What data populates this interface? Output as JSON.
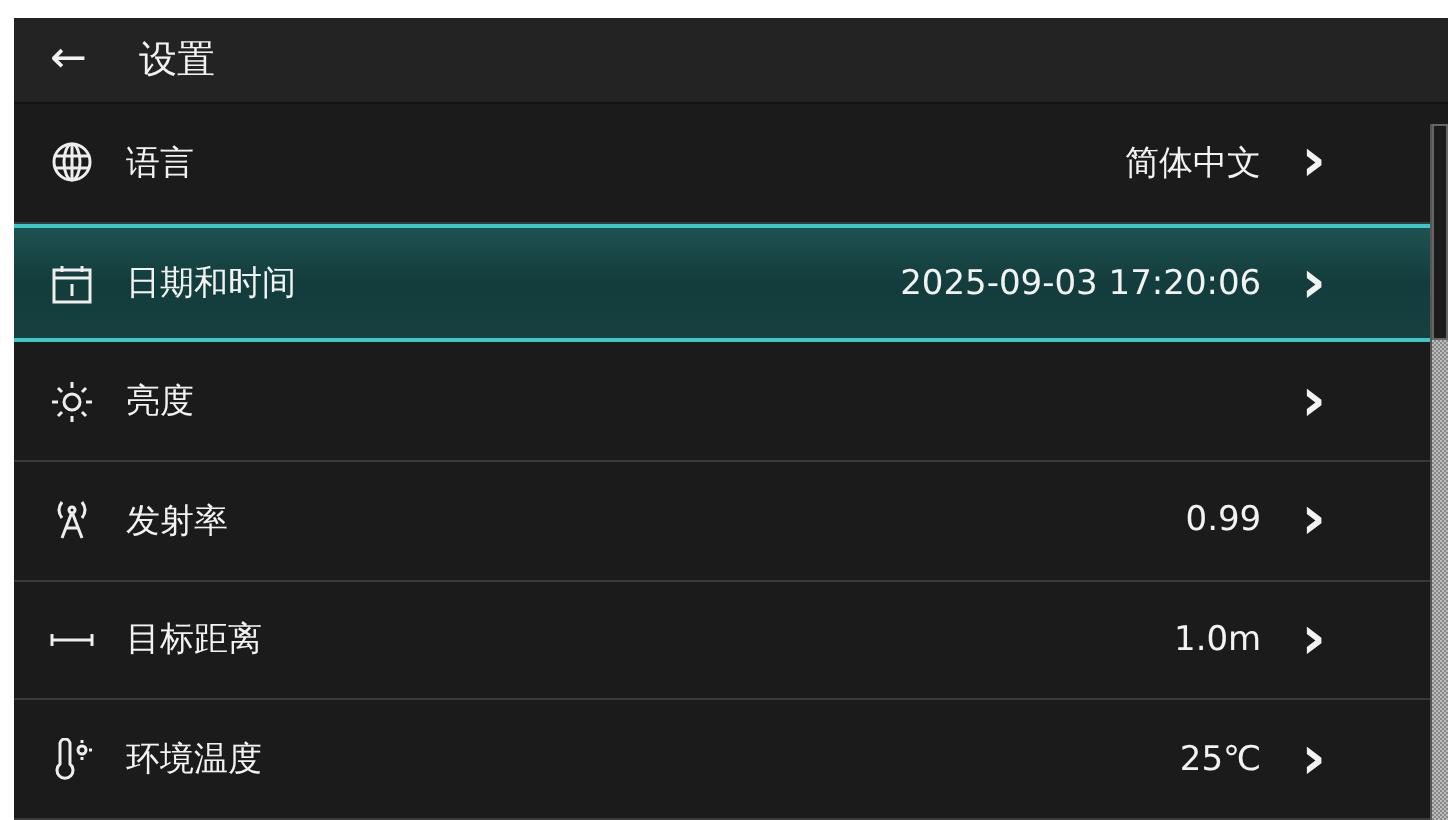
{
  "header": {
    "back": "←",
    "title": "设置"
  },
  "items": [
    {
      "label": "语言",
      "value": "简体中文",
      "chevron": "›",
      "selected": false
    },
    {
      "label": "日期和时间",
      "value": "2025-09-03 17:20:06",
      "chevron": "›",
      "selected": true
    },
    {
      "label": "亮度",
      "chevron": "›",
      "selected": false
    },
    {
      "label": "发射率",
      "value": "0.99",
      "chevron": "›",
      "selected": false
    },
    {
      "label": "目标距离",
      "value": "1.0m",
      "chevron": "›",
      "selected": false
    },
    {
      "label": "环境温度",
      "value": "25℃",
      "chevron": "›",
      "selected": false
    }
  ]
}
